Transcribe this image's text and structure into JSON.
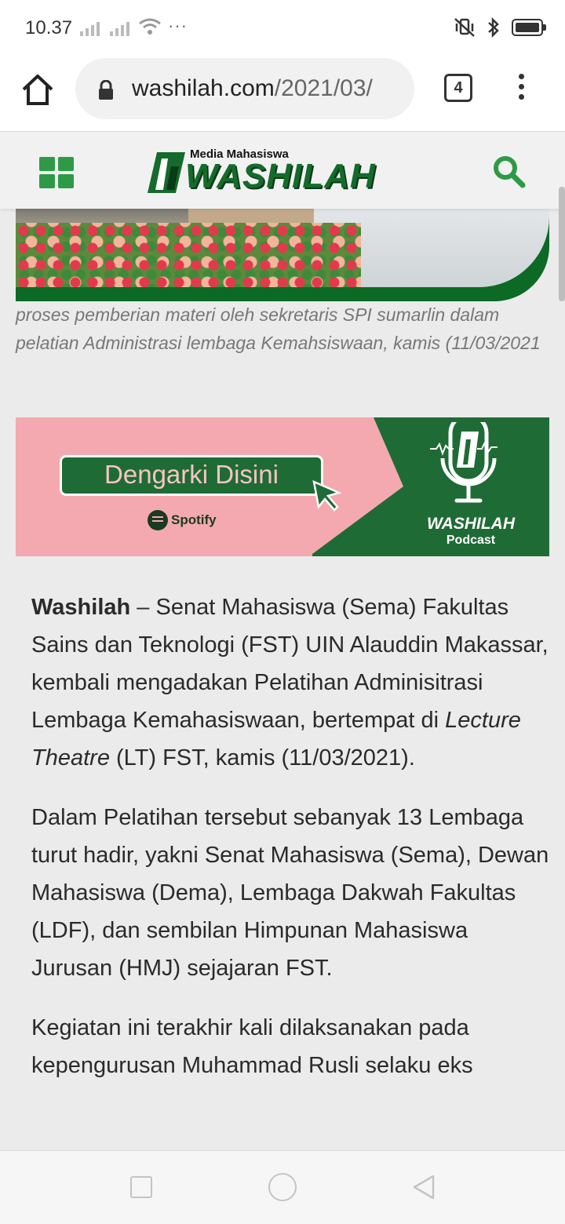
{
  "status_bar": {
    "time": "10.37",
    "more": "···"
  },
  "browser": {
    "url_domain": "washilah.com",
    "url_path": "/2021/03/",
    "tab_count": "4"
  },
  "site": {
    "logo_small": "Media Mahasiswa",
    "logo_big": "WASHILAH",
    "green": "#2e9a47"
  },
  "caption": "proses pemberian materi oleh sekretaris SPI sumarlin dalam pelatian Administrasi lembaga Kemahsiswaan, kamis (11/03/2021",
  "banner": {
    "button_label": "Dengarki Disini",
    "spotify_label": "Spotify",
    "podcast_name": "WASHILAH",
    "podcast_sub": "Podcast"
  },
  "article": {
    "p1_bold": "Washilah",
    "p1_a": " – Senat Mahasiswa (Sema) Fakultas Sains dan Teknologi (FST)  UIN Alauddin Makassar, kembali mengadakan Pelatihan Adminisitrasi Lembaga Kemahasiswaan,  bertempat di ",
    "p1_italic": "Lecture Theatre",
    "p1_b": " (LT) FST, kamis (11/03/2021).",
    "p2": "Dalam Pelatihan tersebut sebanyak 13 Lembaga turut hadir, yakni Senat Mahasiswa (Sema), Dewan Mahasiswa (Dema), Lembaga Dakwah Fakultas (LDF), dan sembilan Himpunan Mahasiswa Jurusan (HMJ) sejajaran FST.",
    "p3": "Kegiatan ini terakhir kali dilaksanakan pada kepengurusan Muhammad Rusli selaku eks"
  }
}
